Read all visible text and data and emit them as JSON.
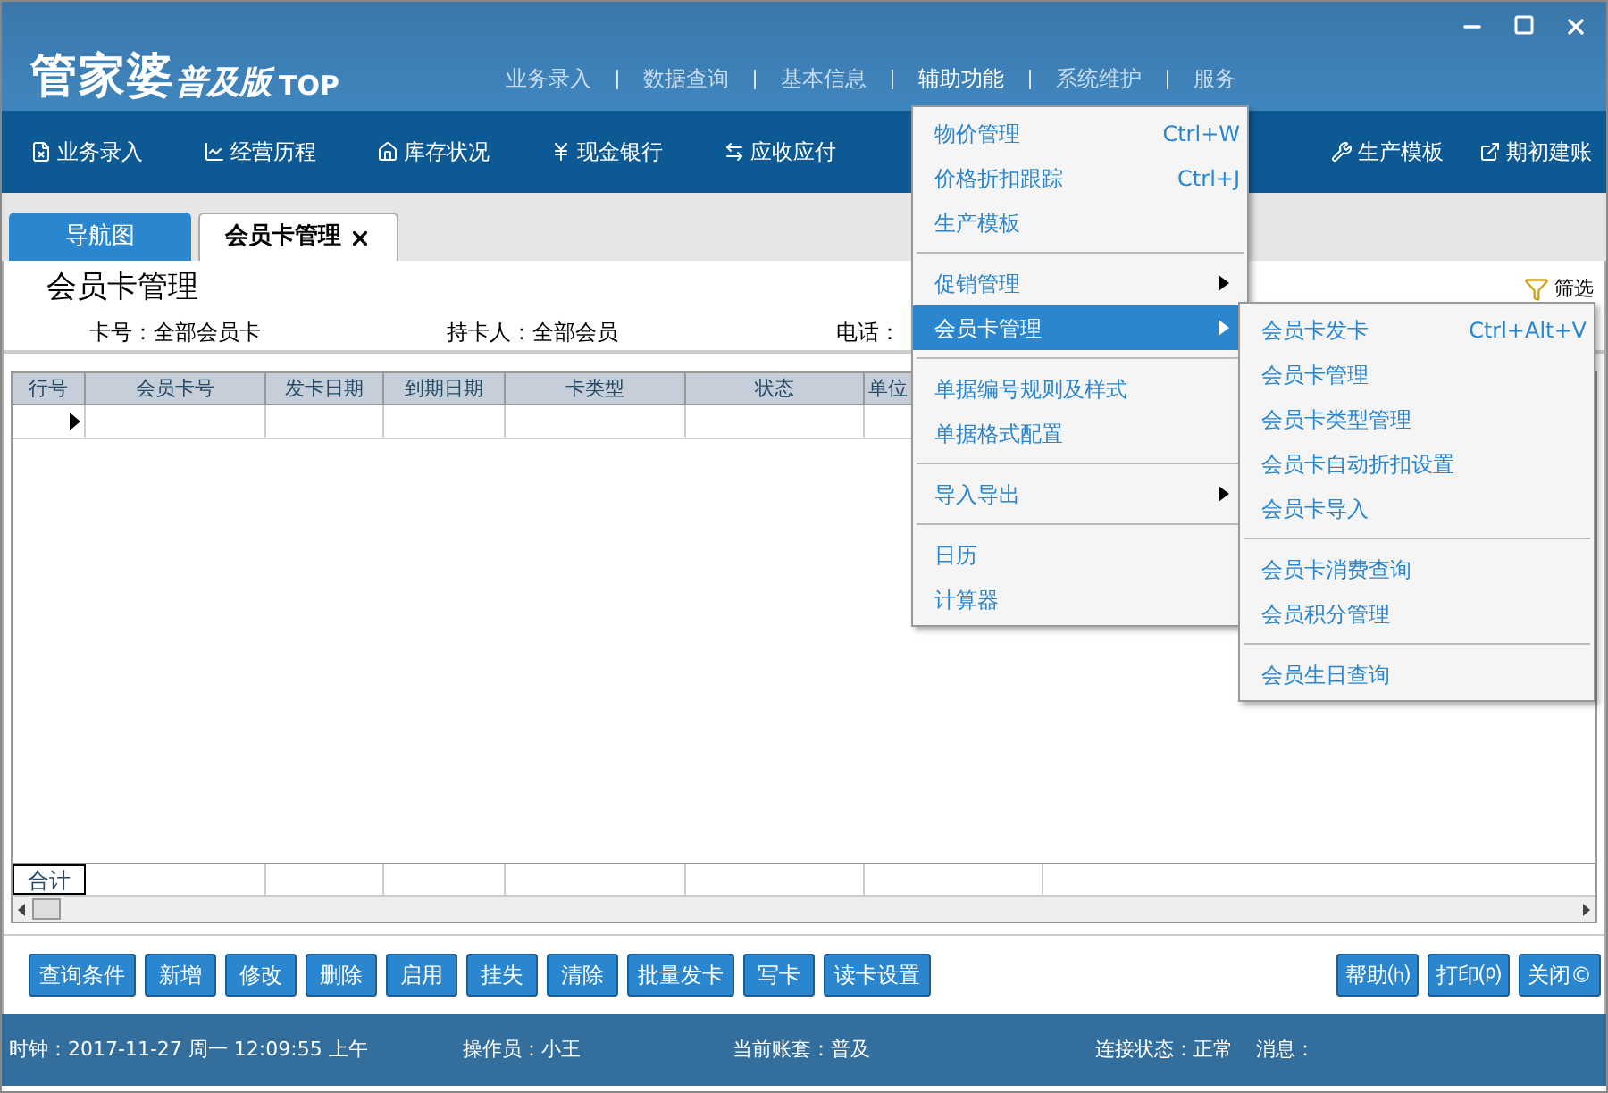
{
  "window": {
    "logo": "管家婆",
    "edition": "普及版",
    "edition_suffix": "TOP",
    "menu": [
      {
        "label": "业务录入",
        "selected": false
      },
      {
        "label": "数据查询",
        "selected": false
      },
      {
        "label": "基本信息",
        "selected": false
      },
      {
        "label": "辅助功能",
        "selected": true
      },
      {
        "label": "系统维护",
        "selected": false
      },
      {
        "label": "服务",
        "selected": false
      }
    ]
  },
  "toolbar": [
    {
      "label": "业务录入"
    },
    {
      "label": "经营历程"
    },
    {
      "label": "库存状况"
    },
    {
      "label": "现金银行"
    },
    {
      "label": "应收应付"
    },
    {
      "label": "生产模板"
    },
    {
      "label": "期初建账"
    }
  ],
  "tabs": [
    {
      "label": "导航图",
      "selected": false,
      "closable": false
    },
    {
      "label": "会员卡管理",
      "selected": true,
      "closable": true
    }
  ],
  "page": {
    "title": "会员卡管理",
    "filter_button": "筛选",
    "filters": [
      {
        "label": "卡号：",
        "value": "全部会员卡"
      },
      {
        "label": "持卡人：",
        "value": "全部会员"
      },
      {
        "label": "电话："
      }
    ]
  },
  "grid": {
    "columns": [
      "行号",
      "会员卡号",
      "发卡日期",
      "到期日期",
      "卡类型",
      "状态",
      "单位"
    ],
    "rows": [
      {
        "current": true
      }
    ],
    "total_label": "合计"
  },
  "buttons_left": [
    "查询条件",
    "新增",
    "修改",
    "删除",
    "启用",
    "挂失",
    "清除",
    "批量发卡",
    "写卡",
    "读卡设置"
  ],
  "buttons_right": [
    "帮助⒣",
    "打印⒫",
    "关闭©"
  ],
  "status_bar": [
    "时钟：2017-11-27 周一 12:09:55 上午",
    "操作员：小王",
    "当前账套：普及",
    "连接状态：正常",
    "消息："
  ],
  "dropdown": {
    "groups": [
      [
        {
          "label": "物价管理",
          "shortcut": "Ctrl+W",
          "submenu": false,
          "selected": false
        },
        {
          "label": "价格折扣跟踪",
          "shortcut": "Ctrl+J",
          "submenu": false,
          "selected": false
        },
        {
          "label": "生产模板",
          "submenu": false,
          "selected": false
        }
      ],
      [
        {
          "label": "促销管理",
          "submenu": true,
          "selected": false
        },
        {
          "label": "会员卡管理",
          "submenu": true,
          "selected": true
        }
      ],
      [
        {
          "label": "单据编号规则及样式",
          "submenu": false,
          "selected": false
        },
        {
          "label": "单据格式配置",
          "submenu": false,
          "selected": false
        }
      ],
      [
        {
          "label": "导入导出",
          "submenu": true,
          "selected": false
        }
      ],
      [
        {
          "label": "日历",
          "submenu": false,
          "selected": false
        },
        {
          "label": "计算器",
          "submenu": false,
          "selected": false
        }
      ]
    ]
  },
  "submenu": {
    "groups": [
      [
        {
          "label": "会员卡发卡",
          "shortcut": "Ctrl+Alt+V"
        },
        {
          "label": "会员卡管理"
        },
        {
          "label": "会员卡类型管理"
        },
        {
          "label": "会员卡自动折扣设置"
        },
        {
          "label": "会员卡导入"
        }
      ],
      [
        {
          "label": "会员卡消费查询"
        },
        {
          "label": "会员积分管理"
        }
      ],
      [
        {
          "label": "会员生日查询"
        }
      ]
    ]
  }
}
